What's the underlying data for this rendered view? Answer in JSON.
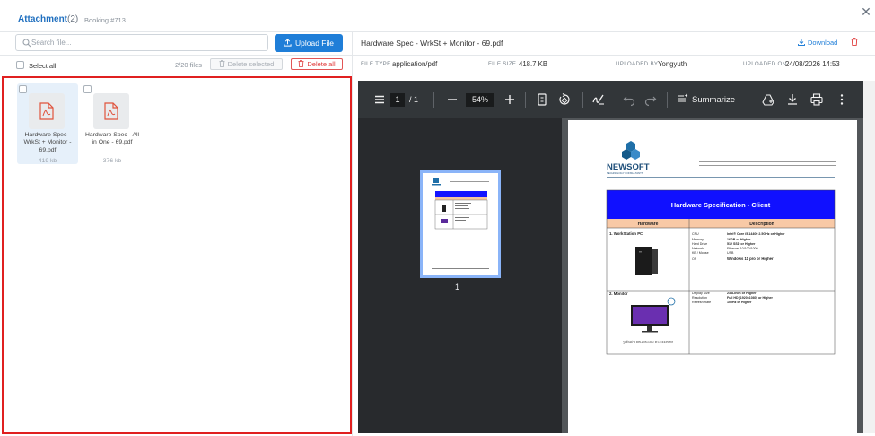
{
  "header": {
    "title": "Attachment",
    "count": "(2)",
    "booking": "Booking #713",
    "close_icon": "close-icon"
  },
  "left": {
    "search_placeholder": "Search file...",
    "upload_label": "Upload File",
    "select_all": "Select all",
    "files_count": "2/20 files",
    "delete_selected": "Delete selected",
    "delete_all": "Delete all",
    "files": [
      {
        "name": "Hardware Spec - WrkSt + Monitor - 69.pdf",
        "size": "419 kb",
        "selected": true,
        "icon": "pdf-file-icon"
      },
      {
        "name": "Hardware Spec - All in One - 69.pdf",
        "size": "376 kb",
        "selected": false,
        "icon": "pdf-file-icon"
      }
    ]
  },
  "right": {
    "file_name": "Hardware Spec - WrkSt + Monitor - 69.pdf",
    "download_label": "Download",
    "meta": {
      "file_type_label": "FILE TYPE",
      "file_type": "application/pdf",
      "file_size_label": "FILE SIZE",
      "file_size": "418.7 KB",
      "uploaded_by_label": "UPLOADED BY",
      "uploaded_by": "Yongyuth",
      "uploaded_on_label": "UPLOADED ON",
      "uploaded_on": "24/08/2026 14:53"
    }
  },
  "viewer": {
    "page_current": "1",
    "page_total": "/ 1",
    "zoom": "54%",
    "summarize": "Summarize",
    "thumb_label": "1",
    "doc": {
      "company": "NEWSOFT",
      "company_sub": "TECHNOLOGY CONSULTANTS",
      "spec_title": "Hardware Specification - Client",
      "col_hardware": "Hardware",
      "col_description": "Description",
      "item1": "1.  WorkStation PC",
      "item1_specs": [
        {
          "k": "CPU",
          "v": "Intel® Core i5-14400 2.5GHz or Higher"
        },
        {
          "k": "Memory",
          "v": "16GB or Higher"
        },
        {
          "k": "Hard Drive",
          "v": "512 SSD or Higher"
        },
        {
          "k": "Network",
          "v": "Ethernet 10/100/1000"
        },
        {
          "k": "KB / Mouse",
          "v": "USB"
        },
        {
          "k": "OS",
          "v": "Windows 11 pro or Higher"
        }
      ],
      "item2": "2.  Monitor",
      "item2_specs": [
        {
          "k": "Display Size",
          "v": "23.8-inch or Higher"
        },
        {
          "k": "Resolution",
          "v": "Full HD (1920x1080) or Higher"
        },
        {
          "k": "Refresh Rate",
          "v": "100Hz or Higher"
        }
      ],
      "monitor_caption": "รูปตัวอย่าง DELL Monitor Pro E2425HM"
    }
  },
  "colors": {
    "accent": "#1f7ed8",
    "danger": "#e03b3b",
    "highlight": "#e02020",
    "viewer_bg": "#333639"
  }
}
